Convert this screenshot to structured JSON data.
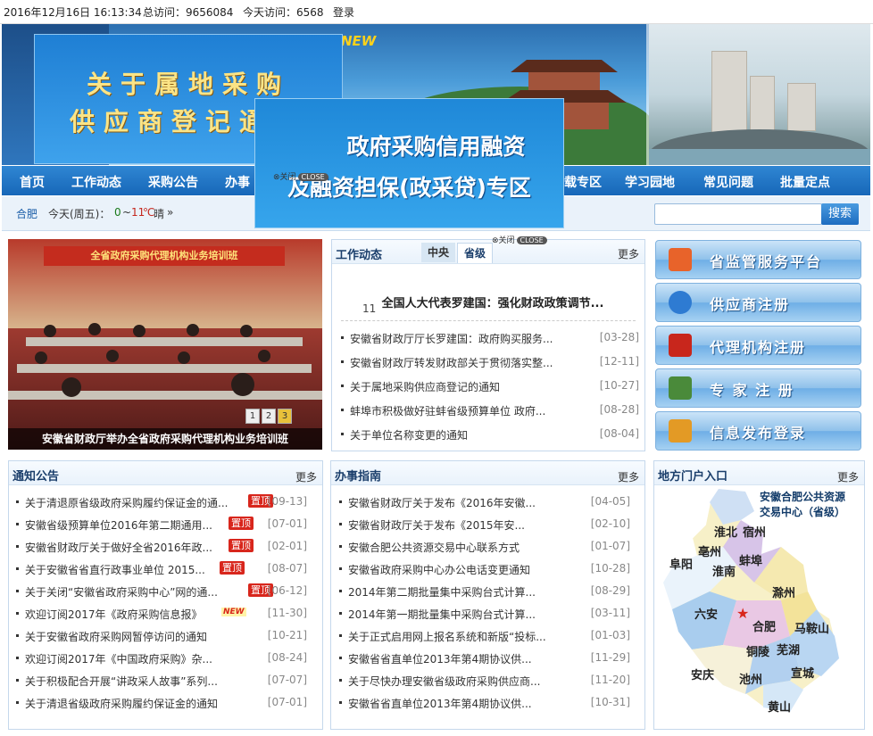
{
  "topbar": {
    "datetime": "2016年12月16日 16:13:34",
    "total_visits": "总访问：9656084",
    "today_visits": "今天访问：6568",
    "login": "登录"
  },
  "banner": {
    "new_label": "NEW"
  },
  "popup1": {
    "line1": "关于属地采购",
    "line2": "供应商登记通知"
  },
  "popup2": {
    "line1": "政府采购信用融资",
    "line2": "及融资担保(政采贷)专区",
    "close_x": "⊗关闭",
    "close_label": "CLOSE"
  },
  "nav": {
    "items": [
      "首页",
      "工作动态",
      "采购公告",
      "办事",
      "载专区",
      "学习园地",
      "常见问题",
      "批量定点"
    ]
  },
  "weather": {
    "city": "合肥",
    "day": "今天(周五)：",
    "low": "0",
    "sep": "~",
    "high": "11",
    "unit": "℃",
    "cond": "晴",
    "arrow": "»"
  },
  "search": {
    "placeholder": "",
    "button": "搜索"
  },
  "slideshow": {
    "banner_text": "全省政府采购代理机构业务培训班",
    "caption": "安徽省财政厅举办全省政府采购代理机构业务培训班",
    "pages": [
      "1",
      "2",
      "3"
    ],
    "active_page": 3
  },
  "work_panel": {
    "title": "工作动态",
    "tabs": [
      "中央",
      "省级"
    ],
    "active_tab": "省级",
    "more": "更多",
    "close_x": "⊗关闭",
    "close_label": "CLOSE",
    "headline": "全国人大代表罗建国：强化财政政策调节...",
    "headline_date": "11",
    "items": [
      {
        "title": "安徽省财政厅厅长罗建国：政府购买服务...",
        "date": "[03-28]"
      },
      {
        "title": "安徽省财政厅转发财政部关于贯彻落实整...",
        "date": "[12-11]"
      },
      {
        "title": "关于属地采购供应商登记的通知",
        "date": "[10-27]"
      },
      {
        "title": "蚌埠市积极做好驻蚌省级预算单位 政府...",
        "date": "[08-28]"
      },
      {
        "title": "关于单位名称变更的通知",
        "date": "[08-04]"
      }
    ]
  },
  "right_buttons": [
    {
      "label": "省监管服务平台",
      "icon": "platform-icon",
      "color": "#e8632a"
    },
    {
      "label": "供应商注册",
      "icon": "ie-icon",
      "color": "#2e7bd2"
    },
    {
      "label": "代理机构注册",
      "icon": "cart-icon",
      "color": "#c8261c"
    },
    {
      "label": "专 家 注 册",
      "icon": "graduation-cap-icon",
      "color": "#4a8a3a"
    },
    {
      "label": "信息发布登录",
      "icon": "pen-icon",
      "color": "#e39a25"
    }
  ],
  "notice_panel": {
    "title": "通知公告",
    "more": "更多",
    "top_tag": "置顶",
    "new_tag": "NEW",
    "items": [
      {
        "title": "关于清退原省级政府采购履约保证金的通...",
        "date": "[09-13]",
        "tag": "top"
      },
      {
        "title": "安徽省级预算单位2016年第二期通用...",
        "date": "[07-01]",
        "tag": "top"
      },
      {
        "title": "安徽省财政厅关于做好全省2016年政...",
        "date": "[02-01]",
        "tag": "top"
      },
      {
        "title": "关于安徽省省直行政事业单位 2015...",
        "date": "[08-07]",
        "tag": "top"
      },
      {
        "title": "关于关闭“安徽省政府采购中心”网的通...",
        "date": "[06-12]",
        "tag": "top"
      },
      {
        "title": "欢迎订阅2017年《政府采购信息报》",
        "date": "[11-30]",
        "tag": "new"
      },
      {
        "title": "关于安徽省政府采购网暂停访问的通知",
        "date": "[10-21]",
        "tag": ""
      },
      {
        "title": "欢迎订阅2017年《中国政府采购》杂...",
        "date": "[08-24]",
        "tag": ""
      },
      {
        "title": "关于积极配合开展“讲政采人故事”系列...",
        "date": "[07-07]",
        "tag": ""
      },
      {
        "title": "关于清退省级政府采购履约保证金的通知",
        "date": "[07-01]",
        "tag": ""
      }
    ]
  },
  "guide_panel": {
    "title": "办事指南",
    "more": "更多",
    "items": [
      {
        "title": "安徽省财政厅关于发布《2016年安徽...",
        "date": "[04-05]"
      },
      {
        "title": "安徽省财政厅关于发布《2015年安...",
        "date": "[02-10]"
      },
      {
        "title": "安徽合肥公共资源交易中心联系方式",
        "date": "[01-07]"
      },
      {
        "title": "安徽省政府采购中心办公电话变更通知",
        "date": "[10-28]"
      },
      {
        "title": "2014年第二期批量集中采购台式计算...",
        "date": "[08-29]"
      },
      {
        "title": "2014年第一期批量集中采购台式计算...",
        "date": "[03-11]"
      },
      {
        "title": "关于正式启用网上报名系统和新版“投标...",
        "date": "[01-03]"
      },
      {
        "title": "安徽省省直单位2013年第4期协议供...",
        "date": "[11-29]"
      },
      {
        "title": "关于尽快办理安徽省级政府采购供应商...",
        "date": "[11-20]"
      },
      {
        "title": "安徽省省直单位2013年第4期协议供...",
        "date": "[10-31]"
      }
    ]
  },
  "portal_panel": {
    "title": "地方门户入口",
    "more": "更多",
    "map_title_1": "安徽合肥公共资源",
    "map_title_2": "交易中心（省级）",
    "cities": [
      "淮北",
      "宿州",
      "亳州",
      "蚌埠",
      "阜阳",
      "淮南",
      "滁州",
      "六安",
      "合肥",
      "马鞍山",
      "铜陵",
      "芜湖",
      "宣城",
      "安庆",
      "池州",
      "黄山"
    ],
    "capital_marker": "★"
  }
}
